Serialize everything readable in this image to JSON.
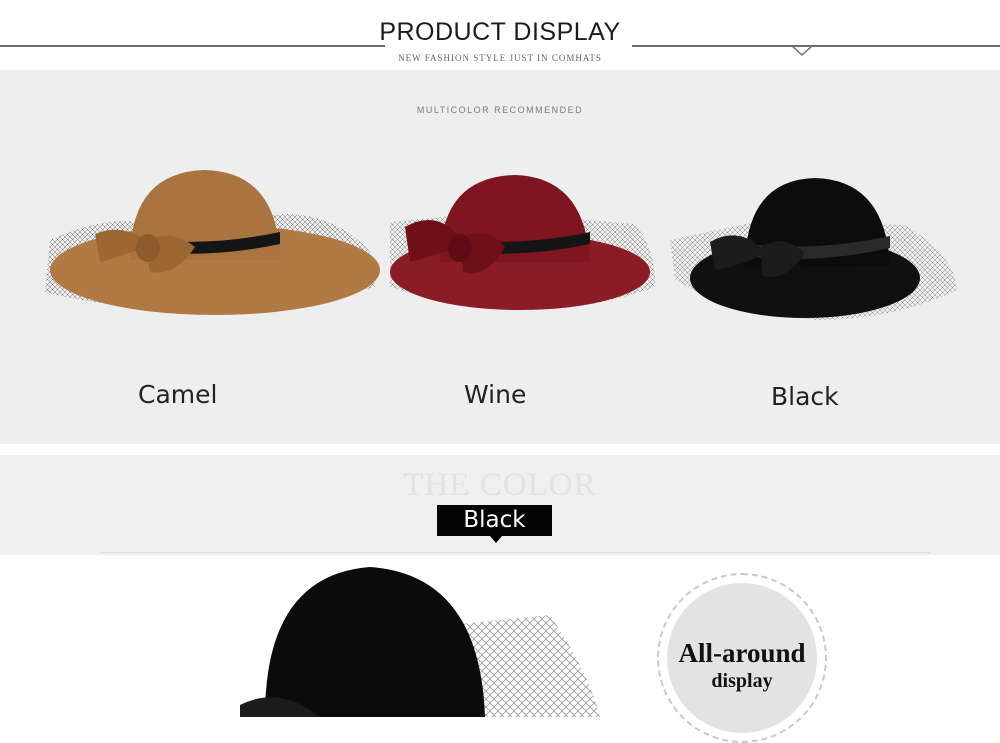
{
  "header": {
    "title": "PRODUCT DISPLAY",
    "subtitle": "NEW FASHION STYLE JUST IN COMHATS"
  },
  "product_panel": {
    "heading": "MULTICOLOR RECOMMENDED",
    "items": [
      {
        "label": "Camel",
        "color": "#a9743f"
      },
      {
        "label": "Wine",
        "color": "#8b1b25"
      },
      {
        "label": "Black",
        "color": "#111111"
      }
    ]
  },
  "color_section": {
    "heading": "THE COLOR",
    "selected": "Black"
  },
  "feature": {
    "line1": "All-around",
    "line2": "display"
  },
  "colors": {
    "panel_bg": "#efeeee",
    "badge_bg": "#050505"
  }
}
